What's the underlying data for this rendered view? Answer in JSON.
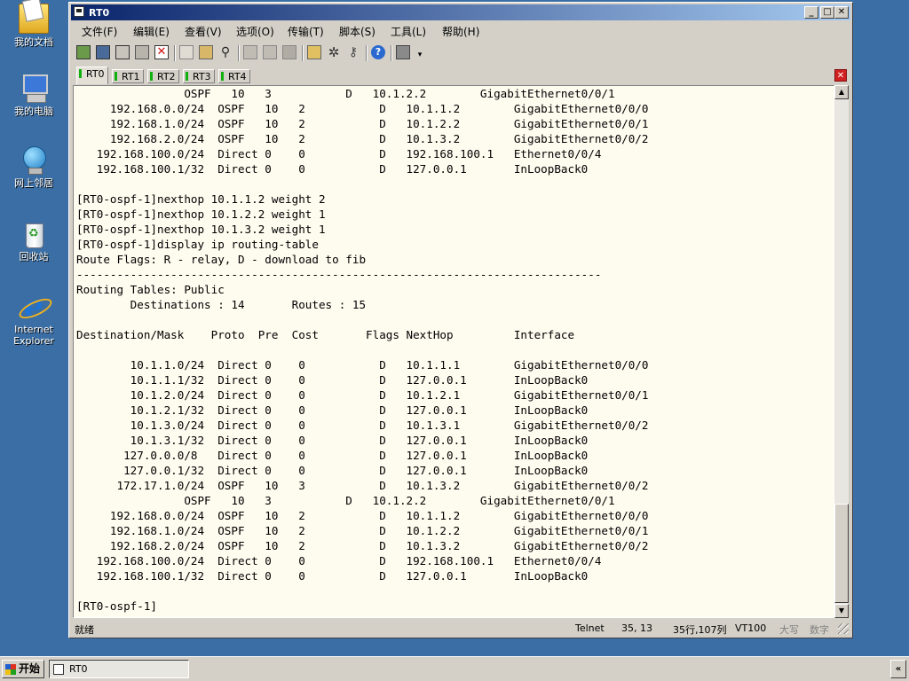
{
  "desktop": {
    "icons": [
      {
        "label": "我的文档"
      },
      {
        "label": "我的电脑"
      },
      {
        "label": "网上邻居"
      },
      {
        "label": "回收站"
      },
      {
        "label": "Internet Explorer"
      }
    ]
  },
  "window": {
    "title": "RT0",
    "controls": {
      "minimize": "_",
      "maximize": "□",
      "close": "✕"
    },
    "menu": [
      "文件(F)",
      "编辑(E)",
      "查看(V)",
      "选项(O)",
      "传输(T)",
      "脚本(S)",
      "工具(L)",
      "帮助(H)"
    ],
    "tabs": [
      "RT0",
      "RT1",
      "RT2",
      "RT3",
      "RT4"
    ],
    "active_tab": "RT0",
    "terminal_lines": [
      "                OSPF   10   3           D   10.1.2.2        GigabitEthernet0/0/1",
      "     192.168.0.0/24  OSPF   10   2           D   10.1.1.2        GigabitEthernet0/0/0",
      "     192.168.1.0/24  OSPF   10   2           D   10.1.2.2        GigabitEthernet0/0/1",
      "     192.168.2.0/24  OSPF   10   2           D   10.1.3.2        GigabitEthernet0/0/2",
      "   192.168.100.0/24  Direct 0    0           D   192.168.100.1   Ethernet0/0/4",
      "   192.168.100.1/32  Direct 0    0           D   127.0.0.1       InLoopBack0",
      "",
      "[RT0-ospf-1]nexthop 10.1.1.2 weight 2",
      "[RT0-ospf-1]nexthop 10.1.2.2 weight 1",
      "[RT0-ospf-1]nexthop 10.1.3.2 weight 1",
      "[RT0-ospf-1]display ip routing-table",
      "Route Flags: R - relay, D - download to fib",
      "------------------------------------------------------------------------------",
      "Routing Tables: Public",
      "        Destinations : 14       Routes : 15",
      "",
      "Destination/Mask    Proto  Pre  Cost       Flags NextHop         Interface",
      "",
      "        10.1.1.0/24  Direct 0    0           D   10.1.1.1        GigabitEthernet0/0/0",
      "        10.1.1.1/32  Direct 0    0           D   127.0.0.1       InLoopBack0",
      "        10.1.2.0/24  Direct 0    0           D   10.1.2.1        GigabitEthernet0/0/1",
      "        10.1.2.1/32  Direct 0    0           D   127.0.0.1       InLoopBack0",
      "        10.1.3.0/24  Direct 0    0           D   10.1.3.1        GigabitEthernet0/0/2",
      "        10.1.3.1/32  Direct 0    0           D   127.0.0.1       InLoopBack0",
      "       127.0.0.0/8   Direct 0    0           D   127.0.0.1       InLoopBack0",
      "       127.0.0.1/32  Direct 0    0           D   127.0.0.1       InLoopBack0",
      "      172.17.1.0/24  OSPF   10   3           D   10.1.3.2        GigabitEthernet0/0/2",
      "                OSPF   10   3           D   10.1.2.2        GigabitEthernet0/0/1",
      "     192.168.0.0/24  OSPF   10   2           D   10.1.1.2        GigabitEthernet0/0/0",
      "     192.168.1.0/24  OSPF   10   2           D   10.1.2.2        GigabitEthernet0/0/1",
      "     192.168.2.0/24  OSPF   10   2           D   10.1.3.2        GigabitEthernet0/0/2",
      "   192.168.100.0/24  Direct 0    0           D   192.168.100.1   Ethernet0/0/4",
      "   192.168.100.1/32  Direct 0    0           D   127.0.0.1       InLoopBack0",
      "",
      "[RT0-ospf-1]"
    ],
    "status": {
      "ready": "就绪",
      "protocol": "Telnet",
      "cursor": "35,  13",
      "rows_cols": "35行,107列",
      "emulation": "VT100",
      "caps": "大写",
      "num": "数字"
    }
  },
  "taskbar": {
    "start_label": "开始",
    "task_label": "RT0",
    "tray_label": "«"
  }
}
